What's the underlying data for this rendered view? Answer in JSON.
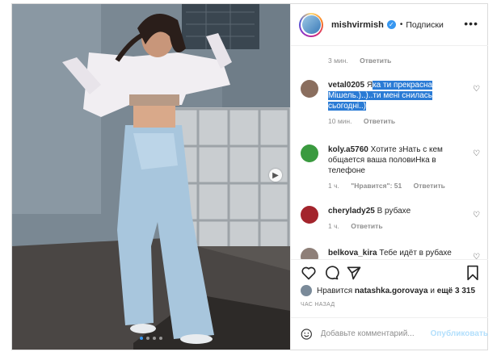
{
  "post": {
    "username": "mishvirmish",
    "separator": "•",
    "follow_label": "Подписки",
    "more_label": "•••",
    "caption_meta": {
      "time": "3 мин.",
      "reply": "Ответить"
    }
  },
  "comments": [
    {
      "user": "vetal0205",
      "text_plain": "Я",
      "text_highlight": "ка ти прекрасна Мішель.)..)..ти мені снилась сьогодні..)",
      "time": "10 мин.",
      "reply": "Ответить"
    },
    {
      "user": "koly.a5760",
      "text": "Хотите зНать с кем общается ваша половиНка в телефоне",
      "time": "1 ч.",
      "likes": "\"Нравится\": 51",
      "reply": "Ответить"
    },
    {
      "user": "cherylady25",
      "text": "В рубахе",
      "time": "1 ч.",
      "reply": "Ответить"
    },
    {
      "user": "belkova_kira",
      "text": "Тебе идёт в рубахе"
    }
  ],
  "likes": {
    "prefix": "Нравится",
    "user": "natashka.gorovaya",
    "and": "и",
    "count": "ещё 3 315"
  },
  "timestamp": "ЧАС НАЗАД",
  "add_comment": {
    "placeholder": "Добавьте комментарий...",
    "publish_label": "Опубликовать"
  },
  "carousel": {
    "slides": 4,
    "active": 0
  },
  "colors": {
    "accent": "#3897f0",
    "highlight": "#2a7bd5",
    "publish_disabled": "#b2dffc"
  }
}
